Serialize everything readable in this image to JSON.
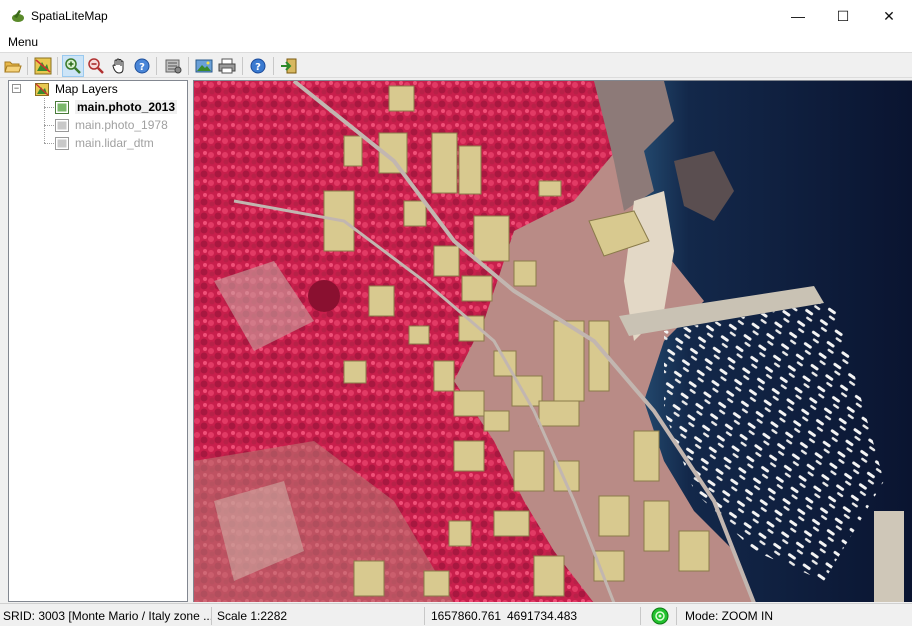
{
  "window": {
    "title": "SpatiaLiteMap",
    "minimize_glyph": "—",
    "maximize_glyph": "☐",
    "close_glyph": "✕"
  },
  "menu": {
    "items": [
      {
        "label": "Menu"
      }
    ]
  },
  "toolbar": {
    "buttons": [
      {
        "icon": "open-folder-icon"
      },
      {
        "icon": "map-layers-icon"
      },
      {
        "icon": "zoom-in-icon",
        "active": true
      },
      {
        "icon": "zoom-out-icon"
      },
      {
        "icon": "pan-hand-icon"
      },
      {
        "icon": "identify-icon"
      },
      {
        "icon": "settings-icon"
      },
      {
        "icon": "export-image-icon"
      },
      {
        "icon": "print-icon"
      },
      {
        "icon": "help-icon"
      },
      {
        "icon": "exit-icon"
      }
    ]
  },
  "tree": {
    "root_label": "Map Layers",
    "expander_glyph": "−",
    "layers": [
      {
        "label": "main.photo_2013",
        "visible": true,
        "selected": true
      },
      {
        "label": "main.photo_1978",
        "visible": false,
        "selected": false
      },
      {
        "label": "main.lidar_dtm",
        "visible": false,
        "selected": false
      }
    ]
  },
  "status": {
    "srid": "SRID: 3003 [Monte Mario / Italy zone ...",
    "scale": "Scale 1:2282",
    "x": "1657860.761",
    "y": "4691734.483",
    "mode": "Mode: ZOOM IN"
  },
  "colors": {
    "vegetation": "#d42a55",
    "sea_deep": "#0d1a38",
    "sea_shallow": "#2c5c83",
    "roof": "#d8c98f",
    "selection": "#cce4f7",
    "gps_ok": "#22c22e"
  }
}
